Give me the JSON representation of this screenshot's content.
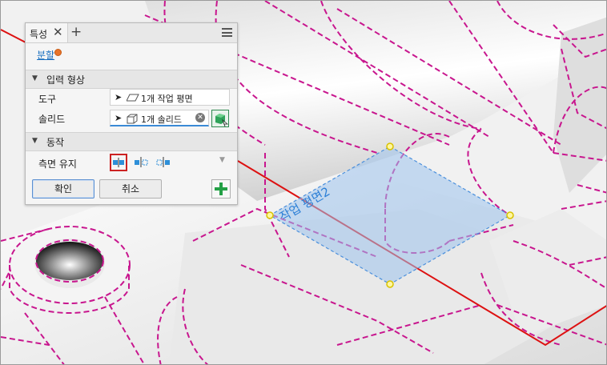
{
  "panel": {
    "tab_label": "특성",
    "tab_close": "✕",
    "tab_add": "+",
    "command_name": "분할",
    "sections": {
      "input": {
        "title": "입력 형상"
      },
      "behavior": {
        "title": "동작"
      }
    },
    "fields": {
      "tool_label": "도구",
      "tool_value": "1개 작업 평면",
      "solid_label": "솔리드",
      "solid_value": "1개 솔리드"
    },
    "side_keep_label": "측면 유지",
    "ok_label": "확인",
    "cancel_label": "취소"
  },
  "viewport": {
    "plane_label": "작업 평면2"
  },
  "colors": {
    "edge": "#c8168e",
    "plane_fill": "#9dc3ec",
    "axis": "#dd1111",
    "accent": "#1a6fc0",
    "selected_border": "#cc2222",
    "add": "#24a046"
  }
}
